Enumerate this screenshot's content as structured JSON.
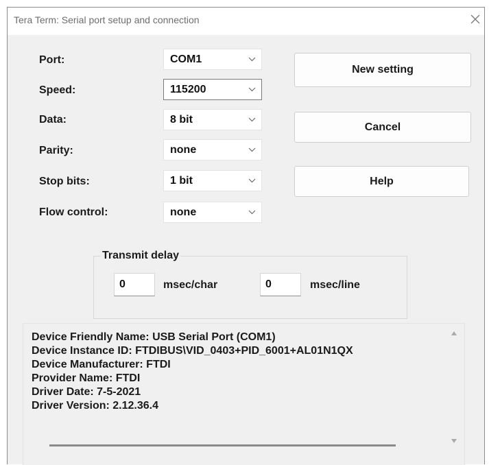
{
  "title": "Tera Term: Serial port setup and connection",
  "fields": {
    "port": {
      "label": "Port:",
      "value": "COM1"
    },
    "speed": {
      "label": "Speed:",
      "value": "115200"
    },
    "data": {
      "label": "Data:",
      "value": "8 bit"
    },
    "parity": {
      "label": "Parity:",
      "value": "none"
    },
    "stop": {
      "label": "Stop bits:",
      "value": "1 bit"
    },
    "flow": {
      "label": "Flow control:",
      "value": "none"
    }
  },
  "buttons": {
    "new_setting": "New setting",
    "cancel": "Cancel",
    "help": "Help"
  },
  "transmit_delay": {
    "legend": "Transmit delay",
    "char_value": "0",
    "char_unit": "msec/char",
    "line_value": "0",
    "line_unit": "msec/line"
  },
  "device_info": [
    "Device Friendly Name: USB Serial Port (COM1)",
    "Device Instance ID: FTDIBUS\\VID_0403+PID_6001+AL01N1QX",
    "Device Manufacturer: FTDI",
    "Provider Name: FTDI",
    "Driver Date: 7-5-2021",
    "Driver Version: 2.12.36.4"
  ],
  "icons": {
    "close": "close-icon",
    "dropdown": "chevron-down-icon",
    "scroll_up": "scroll-up-arrow-icon",
    "scroll_down": "scroll-down-arrow-icon"
  },
  "colors": {
    "dialog_bg": "#f0f0f0",
    "titlebar_bg": "#ffffff",
    "title_text": "#6d6d6d"
  }
}
